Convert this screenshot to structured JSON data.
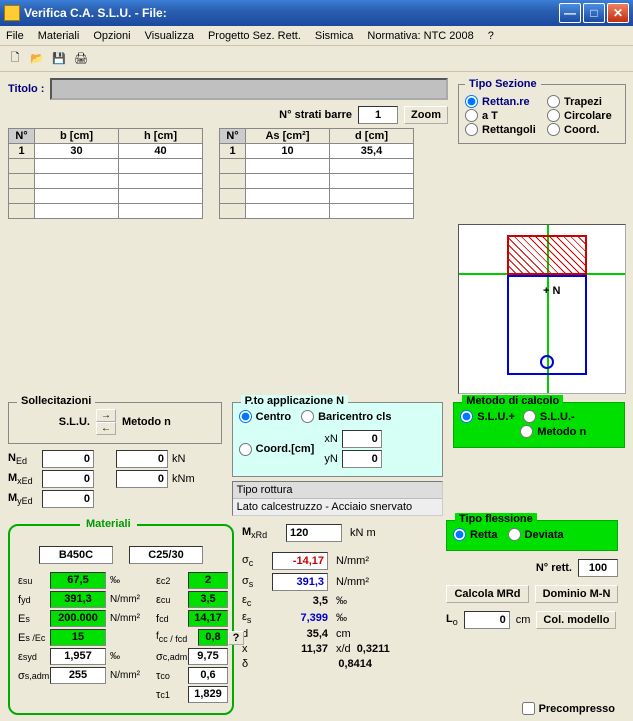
{
  "window": {
    "title": "Verifica C.A. S.L.U. - File:"
  },
  "menu": {
    "file": "File",
    "materiali": "Materiali",
    "opzioni": "Opzioni",
    "visualizza": "Visualizza",
    "progetto": "Progetto Sez. Rett.",
    "sismica": "Sismica",
    "normativa": "Normativa: NTC 2008",
    "help": "?"
  },
  "titolo": {
    "label": "Titolo :",
    "value": ""
  },
  "strati": {
    "label": "N° strati barre",
    "value": "1",
    "zoom": "Zoom"
  },
  "section_table": {
    "headers": [
      "N°",
      "b [cm]",
      "h [cm]"
    ],
    "row": [
      "1",
      "30",
      "40"
    ]
  },
  "bars_table": {
    "headers": [
      "N°",
      "As [cm²]",
      "d [cm]"
    ],
    "row": [
      "1",
      "10",
      "35,4"
    ]
  },
  "tipo_sezione": {
    "legend": "Tipo Sezione",
    "rettanre": "Rettan.re",
    "trapezi": "Trapezi",
    "aT": "a T",
    "circolare": "Circolare",
    "rettangoli": "Rettangoli",
    "coord": "Coord."
  },
  "solle": {
    "legend": "Sollecitazioni",
    "slu": "S.L.U.",
    "metodon": "Metodo n"
  },
  "forces": {
    "N_label": "N",
    "M_label": "M",
    "Ed": "Ed",
    "xEd": "xEd",
    "yEd": "yEd",
    "kN": "kN",
    "kNm": "kNm",
    "NEd": "0",
    "N2": "0",
    "MxEd": "0",
    "M2": "0",
    "MyEd": "0"
  },
  "punto": {
    "legend": "P.to applicazione N",
    "centro": "Centro",
    "baricentro": "Baricentro cls",
    "coord": "Coord.[cm]",
    "xN": "xN",
    "yN": "yN",
    "xN_v": "0",
    "yN_v": "0"
  },
  "tipor": {
    "legend": "Tipo rottura",
    "value": "Lato calcestruzzo - Acciaio snervato"
  },
  "materiali": {
    "legend": "Materiali",
    "steel": "B450C",
    "concrete": "C25/30",
    "esu_l": "ε",
    "esu_s": "su",
    "esu": "67,5",
    "permil": "‰",
    "ec2_l": "ε",
    "ec2_s": "c2",
    "ec2": "2",
    "fyd_l": "f",
    "fyd_s": "yd",
    "fyd": "391,3",
    "nmm2": "N/mm²",
    "ecu_l": "ε",
    "ecu_s": "cu",
    "ecu": "3,5",
    "Es_l": "E",
    "Es_s": "s",
    "Es": "200.000",
    "fcd_l": "f",
    "fcd_s": "cd",
    "fcd": "14,17",
    "EsEc_l": "E",
    "EsEc": "15",
    "EsEc_lab": "s /Ec",
    "fccfcd_l": "f",
    "fccfcd_lab": "cc / fcd",
    "fccfcd": "0,8",
    "q": "?",
    "esyd_l": "ε",
    "esyd_s": "syd",
    "esyd": "1,957",
    "scadm_l": "σ",
    "scadm_s": "c,adm",
    "scadm": "9,75",
    "sadm_l": "σ",
    "sadm_s": "s,adm",
    "sadm": "255",
    "tco_l": "τ",
    "tco_s": "co",
    "tco": "0,6",
    "tc1_l": "τ",
    "tc1_s": "c1",
    "tc1": "1,829"
  },
  "results": {
    "MxRd_l": "M",
    "MxRd_s": "xRd",
    "MxRd": "120",
    "knm": "kN m",
    "sc_l": "σ",
    "sc_s": "c",
    "sc": "-14,17",
    "ss_l": "σ",
    "ss_s": "s",
    "ss": "391,3",
    "ec_l": "ε",
    "ec_s": "c",
    "ec": "3,5",
    "es_l": "ε",
    "es_s": "s",
    "es": "7,399",
    "d_l": "d",
    "d": "35,4",
    "cm": "cm",
    "x_l": "x",
    "x": "11,37",
    "xd_l": "x/d",
    "xd": "0,3211",
    "delta_l": "δ",
    "delta": "0,8414",
    "nmm2": "N/mm²",
    "permil": "‰"
  },
  "metodo_calc": {
    "legend": "Metodo di calcolo",
    "slu_p": "S.L.U.+",
    "slu_m": "S.L.U.-",
    "metodon": "Metodo n"
  },
  "tipo_fless": {
    "legend": "Tipo flessione",
    "retta": "Retta",
    "deviata": "Deviata"
  },
  "nrett": {
    "label": "N° rett.",
    "value": "100"
  },
  "buttons": {
    "calcola": "Calcola MRd",
    "dominio": "Dominio M-N",
    "colmodello": "Col. modello"
  },
  "Lo": {
    "label": "L",
    "sub": "o",
    "value": "0",
    "unit": "cm"
  },
  "precomp": {
    "label": "Precompresso"
  },
  "canvas": {
    "N": "N"
  }
}
